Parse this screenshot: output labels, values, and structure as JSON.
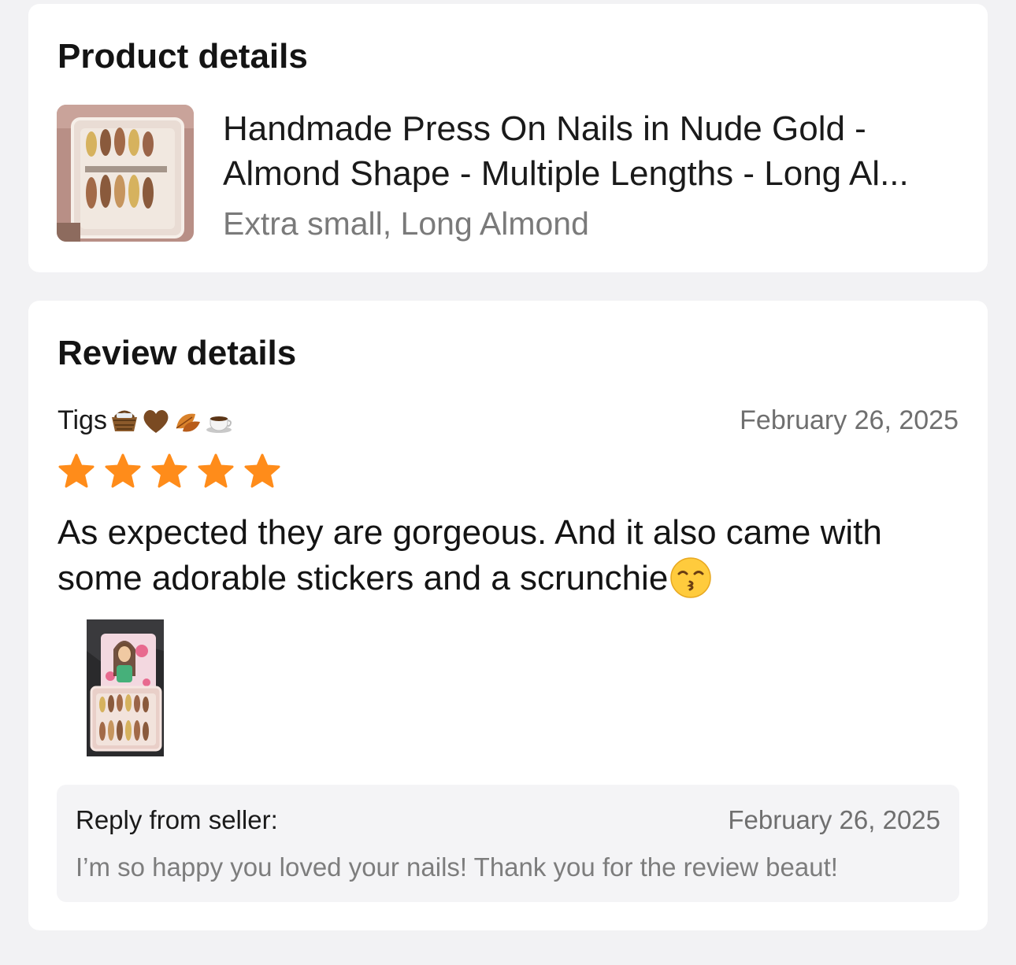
{
  "product_details": {
    "title": "Product details",
    "product_title": "Handmade Press On Nails in Nude Gold - Almond Shape - Multiple Lengths -  Long Al...",
    "variant": "Extra small, Long Almond",
    "thumbnail_icon": "product-photo-nails-box"
  },
  "review_details": {
    "title": "Review details",
    "reviewer_name": "Tigs",
    "reviewer_emojis": [
      "basket-emoji",
      "brown-heart-emoji",
      "fallen-leaf-emoji",
      "hot-coffee-emoji"
    ],
    "date": "February 26, 2025",
    "rating": 5,
    "rating_max": 5,
    "star_color": "#ff8c1a",
    "text": "As expected they are gorgeous. And it also came with some adorable stickers and a scrunchie",
    "text_emoji": "kissing-face-emoji",
    "photo_icon": "review-photo-nails-stickers",
    "seller_reply": {
      "label": "Reply from seller:",
      "date": "February 26, 2025",
      "text": "I’m so happy you loved your nails! Thank you for the review beaut!"
    }
  }
}
